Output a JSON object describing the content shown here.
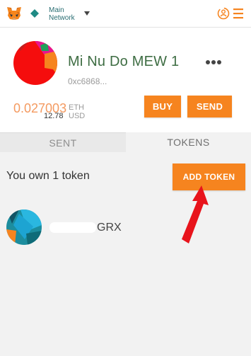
{
  "header": {
    "network_name_line1": "Main",
    "network_name_line2": "Network",
    "icons": [
      "metamask-fox-icon",
      "network-diamond-icon",
      "chevron-down-icon",
      "account-sync-icon",
      "hamburger-menu-icon"
    ]
  },
  "account": {
    "name": "Mi Nu Do MEW 1",
    "address": "0xc6868...",
    "balance_eth": "0.027003",
    "eth_unit": "ETH",
    "balance_usd": "12.78",
    "usd_unit": "USD",
    "buy_label": "BUY",
    "send_label": "SEND"
  },
  "tabs": [
    {
      "label": "SENT",
      "active": false
    },
    {
      "label": "TOKENS",
      "active": true
    }
  ],
  "tokens_panel": {
    "own_text": "You own 1 token",
    "add_token_label": "ADD TOKEN",
    "tokens": [
      {
        "symbol": "GRX"
      }
    ]
  },
  "colors": {
    "accent": "#f6841f",
    "balance": "#f49a60",
    "account_name": "#3e6d43",
    "network": "#2a6e73",
    "annotation_arrow": "#e8141c"
  }
}
